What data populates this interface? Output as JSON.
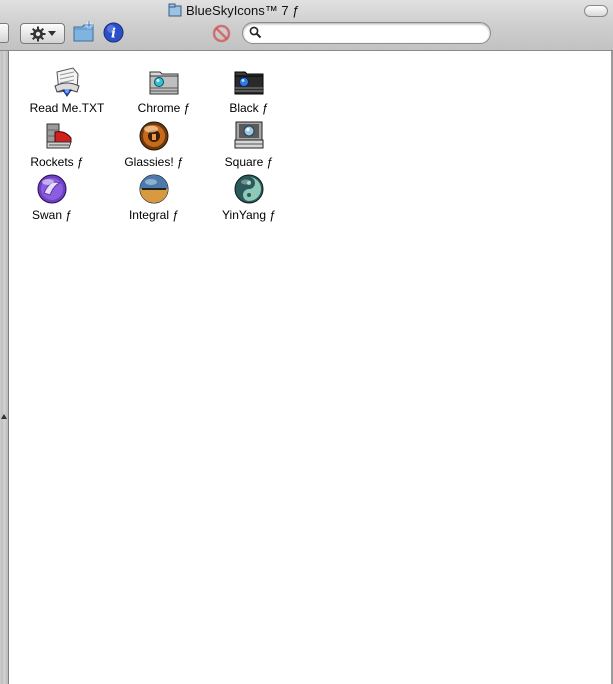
{
  "window": {
    "title": "BlueSkyIcons™ 7 ƒ"
  },
  "toolbar": {
    "search_value": "",
    "search_placeholder": ""
  },
  "items": [
    {
      "label": "Read Me.TXT",
      "icon": "readme-document-icon"
    },
    {
      "label": "Chrome ƒ",
      "icon": "chrome-folder-icon"
    },
    {
      "label": "Black ƒ",
      "icon": "black-folder-icon"
    },
    {
      "label": "Rockets ƒ",
      "icon": "rockets-folder-icon"
    },
    {
      "label": "Glassies! ƒ",
      "icon": "glassies-folder-icon"
    },
    {
      "label": "Square ƒ",
      "icon": "square-folder-icon"
    },
    {
      "label": "Swan ƒ",
      "icon": "swan-folder-icon"
    },
    {
      "label": "Integral ƒ",
      "icon": "integral-folder-icon"
    },
    {
      "label": "YinYang ƒ",
      "icon": "yinyang-folder-icon"
    }
  ],
  "colors": {
    "toolbar_metal": "#d0d0d0",
    "info_blue": "#2a4fc9",
    "folder_blue": "#6aa6d8",
    "stop_red": "#d24a4a"
  }
}
